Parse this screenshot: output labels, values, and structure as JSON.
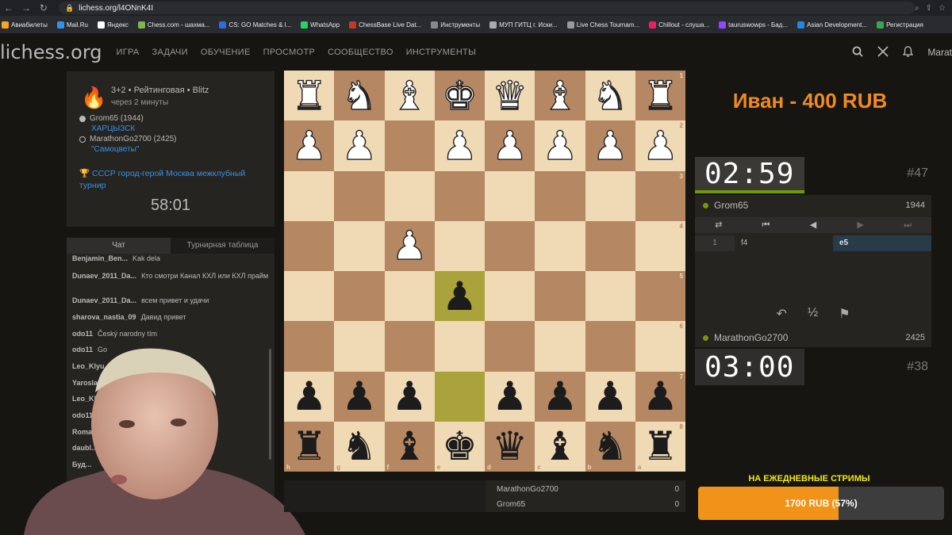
{
  "browser": {
    "url": "lichess.org/l4ONnK4I",
    "bookmarks": [
      {
        "label": "Авиабилеты",
        "color": "#f6a623"
      },
      {
        "label": "Mail.Ru",
        "color": "#3692e7"
      },
      {
        "label": "Яндекс",
        "color": "#ffffff"
      },
      {
        "label": "Chess.com - шахма...",
        "color": "#81b64c"
      },
      {
        "label": "CS: GO Matches & l...",
        "color": "#2d6cdf"
      },
      {
        "label": "WhatsApp",
        "color": "#25d366"
      },
      {
        "label": "ChessBase Live Dat...",
        "color": "#c0392b"
      },
      {
        "label": "Инструменты",
        "color": "#888888"
      },
      {
        "label": "МУП ГИТЦ г. Иски...",
        "color": "#aaaaaa"
      },
      {
        "label": "Live Chess Tournam...",
        "color": "#999999"
      },
      {
        "label": "Chillout - слуша...",
        "color": "#e91e63"
      },
      {
        "label": "tauruswowps - Бад...",
        "color": "#9146ff"
      },
      {
        "label": "Asian Development...",
        "color": "#1e88e5"
      },
      {
        "label": "Регистрация",
        "color": "#34a853"
      }
    ]
  },
  "header": {
    "logo": "lichess.org",
    "nav": [
      "ИГРА",
      "ЗАДАЧИ",
      "ОБУЧЕНИЕ",
      "ПРОСМОТР",
      "СООБЩЕСТВО",
      "ИНСТРУМЕНТЫ"
    ],
    "user": "Marat"
  },
  "game_info": {
    "type": "3+2 • Рейтинговая • Blitz",
    "time_ago": "через 2 минуты",
    "white_player": "Grom65 (1944)",
    "white_team": "ХАРЦЫЗСК",
    "black_player": "MarathonGo2700 (2425)",
    "black_team": "\"Самоцветы\"",
    "tournament": "СССР город-герой Москва межклубный турнир",
    "clock": "58:01"
  },
  "chat": {
    "tab_chat": "Чат",
    "tab_standings": "Турнирная таблица",
    "messages": [
      {
        "user": "Benjamin_Ben...",
        "text": "Kak dela"
      },
      {
        "user": "Dunaev_2011_Da...",
        "text": "Кто смотри Канал КХЛ или КХЛ прайм"
      },
      {
        "user": "Dunaev_2011_Da...",
        "text": "всем привет и удачи"
      },
      {
        "user": "sharova_nastia_09",
        "text": "Давид привет"
      },
      {
        "user": "odo11",
        "text": "Český narodny tím"
      },
      {
        "user": "odo11",
        "text": "Go"
      },
      {
        "user": "Leo_Klyu...",
        "text": ""
      },
      {
        "user": "Yaroslav...",
        "text": ""
      },
      {
        "user": "Leo_Kly...",
        "text": ""
      },
      {
        "user": "odo11",
        "text": ""
      },
      {
        "user": "Roma...",
        "text": ""
      },
      {
        "user": "daubl...",
        "text": ""
      },
      {
        "user": "Буд...",
        "text": ""
      }
    ]
  },
  "board": {
    "ranks": [
      "1",
      "2",
      "3",
      "4",
      "5",
      "6",
      "7",
      "8"
    ],
    "files": [
      "h",
      "g",
      "f",
      "e",
      "d",
      "c",
      "b",
      "a"
    ],
    "rows": [
      [
        "wR",
        "wN",
        "wB",
        "wK",
        "wQ",
        "wB",
        "wN",
        "wR"
      ],
      [
        "wP",
        "wP",
        "",
        "wP",
        "wP",
        "wP",
        "wP",
        "wP"
      ],
      [
        "",
        "",
        "",
        "",
        "",
        "",
        "",
        ""
      ],
      [
        "",
        "",
        "wP",
        "",
        "",
        "",
        "",
        ""
      ],
      [
        "",
        "",
        "",
        "bP",
        "",
        "",
        "",
        ""
      ],
      [
        "",
        "",
        "",
        "",
        "",
        "",
        "",
        ""
      ],
      [
        "bP",
        "bP",
        "bP",
        "",
        "bP",
        "bP",
        "bP",
        "bP"
      ],
      [
        "bR",
        "bN",
        "bB",
        "bK",
        "bQ",
        "bB",
        "bN",
        "bR"
      ]
    ],
    "highlights": [
      [
        4,
        3
      ],
      [
        6,
        3
      ]
    ]
  },
  "scores": [
    {
      "name": "MarathonGo2700",
      "score": "0"
    },
    {
      "name": "Grom65",
      "score": "0"
    }
  ],
  "overlay": {
    "title": "Иван - 400 RUB",
    "donate_label": "НА ЕЖЕДНЕВНЫЕ СТРИМЫ",
    "donate_text": "1700 RUB (57%)",
    "donate_fraction": 0.57
  },
  "clocks": {
    "top": "02:59",
    "top_move": "#47",
    "bottom": "03:00",
    "bottom_move": "#38"
  },
  "side_panel": {
    "top_player": "Grom65",
    "top_rating": "1944",
    "bottom_player": "MarathonGo2700",
    "bottom_rating": "2425",
    "move_number": "1",
    "white_move": "f4",
    "black_move": "e5",
    "takeback": "↶",
    "draw": "½",
    "resign": "⚑"
  }
}
